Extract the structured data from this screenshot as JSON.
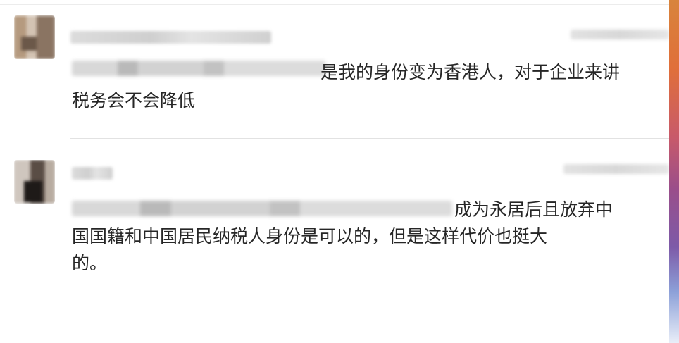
{
  "comments": [
    {
      "text_line1_visible": "是我的身份变为香港人，对于企业来讲",
      "text_line2": "税务会不会降低"
    },
    {
      "text_line1_visible": "成为永居后且放弃中",
      "text_line2": "国国籍和中国居民纳税人身份是可以的，但是这样代价也挺大",
      "text_line3": "的。"
    }
  ]
}
